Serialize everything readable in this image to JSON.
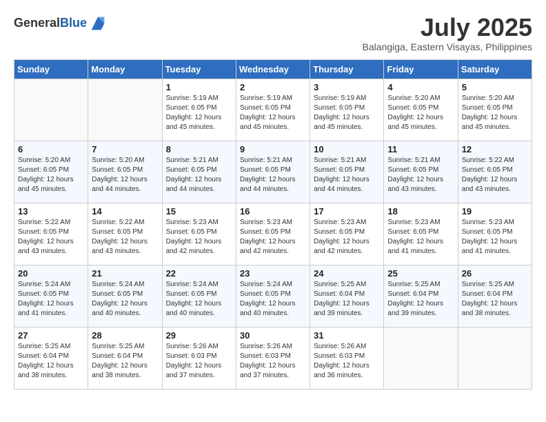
{
  "logo": {
    "general": "General",
    "blue": "Blue"
  },
  "title": {
    "month_year": "July 2025",
    "location": "Balangiga, Eastern Visayas, Philippines"
  },
  "weekdays": [
    "Sunday",
    "Monday",
    "Tuesday",
    "Wednesday",
    "Thursday",
    "Friday",
    "Saturday"
  ],
  "weeks": [
    [
      {
        "day": "",
        "detail": ""
      },
      {
        "day": "",
        "detail": ""
      },
      {
        "day": "1",
        "detail": "Sunrise: 5:19 AM\nSunset: 6:05 PM\nDaylight: 12 hours and 45 minutes."
      },
      {
        "day": "2",
        "detail": "Sunrise: 5:19 AM\nSunset: 6:05 PM\nDaylight: 12 hours and 45 minutes."
      },
      {
        "day": "3",
        "detail": "Sunrise: 5:19 AM\nSunset: 6:05 PM\nDaylight: 12 hours and 45 minutes."
      },
      {
        "day": "4",
        "detail": "Sunrise: 5:20 AM\nSunset: 6:05 PM\nDaylight: 12 hours and 45 minutes."
      },
      {
        "day": "5",
        "detail": "Sunrise: 5:20 AM\nSunset: 6:05 PM\nDaylight: 12 hours and 45 minutes."
      }
    ],
    [
      {
        "day": "6",
        "detail": "Sunrise: 5:20 AM\nSunset: 6:05 PM\nDaylight: 12 hours and 45 minutes."
      },
      {
        "day": "7",
        "detail": "Sunrise: 5:20 AM\nSunset: 6:05 PM\nDaylight: 12 hours and 44 minutes."
      },
      {
        "day": "8",
        "detail": "Sunrise: 5:21 AM\nSunset: 6:05 PM\nDaylight: 12 hours and 44 minutes."
      },
      {
        "day": "9",
        "detail": "Sunrise: 5:21 AM\nSunset: 6:05 PM\nDaylight: 12 hours and 44 minutes."
      },
      {
        "day": "10",
        "detail": "Sunrise: 5:21 AM\nSunset: 6:05 PM\nDaylight: 12 hours and 44 minutes."
      },
      {
        "day": "11",
        "detail": "Sunrise: 5:21 AM\nSunset: 6:05 PM\nDaylight: 12 hours and 43 minutes."
      },
      {
        "day": "12",
        "detail": "Sunrise: 5:22 AM\nSunset: 6:05 PM\nDaylight: 12 hours and 43 minutes."
      }
    ],
    [
      {
        "day": "13",
        "detail": "Sunrise: 5:22 AM\nSunset: 6:05 PM\nDaylight: 12 hours and 43 minutes."
      },
      {
        "day": "14",
        "detail": "Sunrise: 5:22 AM\nSunset: 6:05 PM\nDaylight: 12 hours and 43 minutes."
      },
      {
        "day": "15",
        "detail": "Sunrise: 5:23 AM\nSunset: 6:05 PM\nDaylight: 12 hours and 42 minutes."
      },
      {
        "day": "16",
        "detail": "Sunrise: 5:23 AM\nSunset: 6:05 PM\nDaylight: 12 hours and 42 minutes."
      },
      {
        "day": "17",
        "detail": "Sunrise: 5:23 AM\nSunset: 6:05 PM\nDaylight: 12 hours and 42 minutes."
      },
      {
        "day": "18",
        "detail": "Sunrise: 5:23 AM\nSunset: 6:05 PM\nDaylight: 12 hours and 41 minutes."
      },
      {
        "day": "19",
        "detail": "Sunrise: 5:23 AM\nSunset: 6:05 PM\nDaylight: 12 hours and 41 minutes."
      }
    ],
    [
      {
        "day": "20",
        "detail": "Sunrise: 5:24 AM\nSunset: 6:05 PM\nDaylight: 12 hours and 41 minutes."
      },
      {
        "day": "21",
        "detail": "Sunrise: 5:24 AM\nSunset: 6:05 PM\nDaylight: 12 hours and 40 minutes."
      },
      {
        "day": "22",
        "detail": "Sunrise: 5:24 AM\nSunset: 6:05 PM\nDaylight: 12 hours and 40 minutes."
      },
      {
        "day": "23",
        "detail": "Sunrise: 5:24 AM\nSunset: 6:05 PM\nDaylight: 12 hours and 40 minutes."
      },
      {
        "day": "24",
        "detail": "Sunrise: 5:25 AM\nSunset: 6:04 PM\nDaylight: 12 hours and 39 minutes."
      },
      {
        "day": "25",
        "detail": "Sunrise: 5:25 AM\nSunset: 6:04 PM\nDaylight: 12 hours and 39 minutes."
      },
      {
        "day": "26",
        "detail": "Sunrise: 5:25 AM\nSunset: 6:04 PM\nDaylight: 12 hours and 38 minutes."
      }
    ],
    [
      {
        "day": "27",
        "detail": "Sunrise: 5:25 AM\nSunset: 6:04 PM\nDaylight: 12 hours and 38 minutes."
      },
      {
        "day": "28",
        "detail": "Sunrise: 5:25 AM\nSunset: 6:04 PM\nDaylight: 12 hours and 38 minutes."
      },
      {
        "day": "29",
        "detail": "Sunrise: 5:26 AM\nSunset: 6:03 PM\nDaylight: 12 hours and 37 minutes."
      },
      {
        "day": "30",
        "detail": "Sunrise: 5:26 AM\nSunset: 6:03 PM\nDaylight: 12 hours and 37 minutes."
      },
      {
        "day": "31",
        "detail": "Sunrise: 5:26 AM\nSunset: 6:03 PM\nDaylight: 12 hours and 36 minutes."
      },
      {
        "day": "",
        "detail": ""
      },
      {
        "day": "",
        "detail": ""
      }
    ]
  ]
}
